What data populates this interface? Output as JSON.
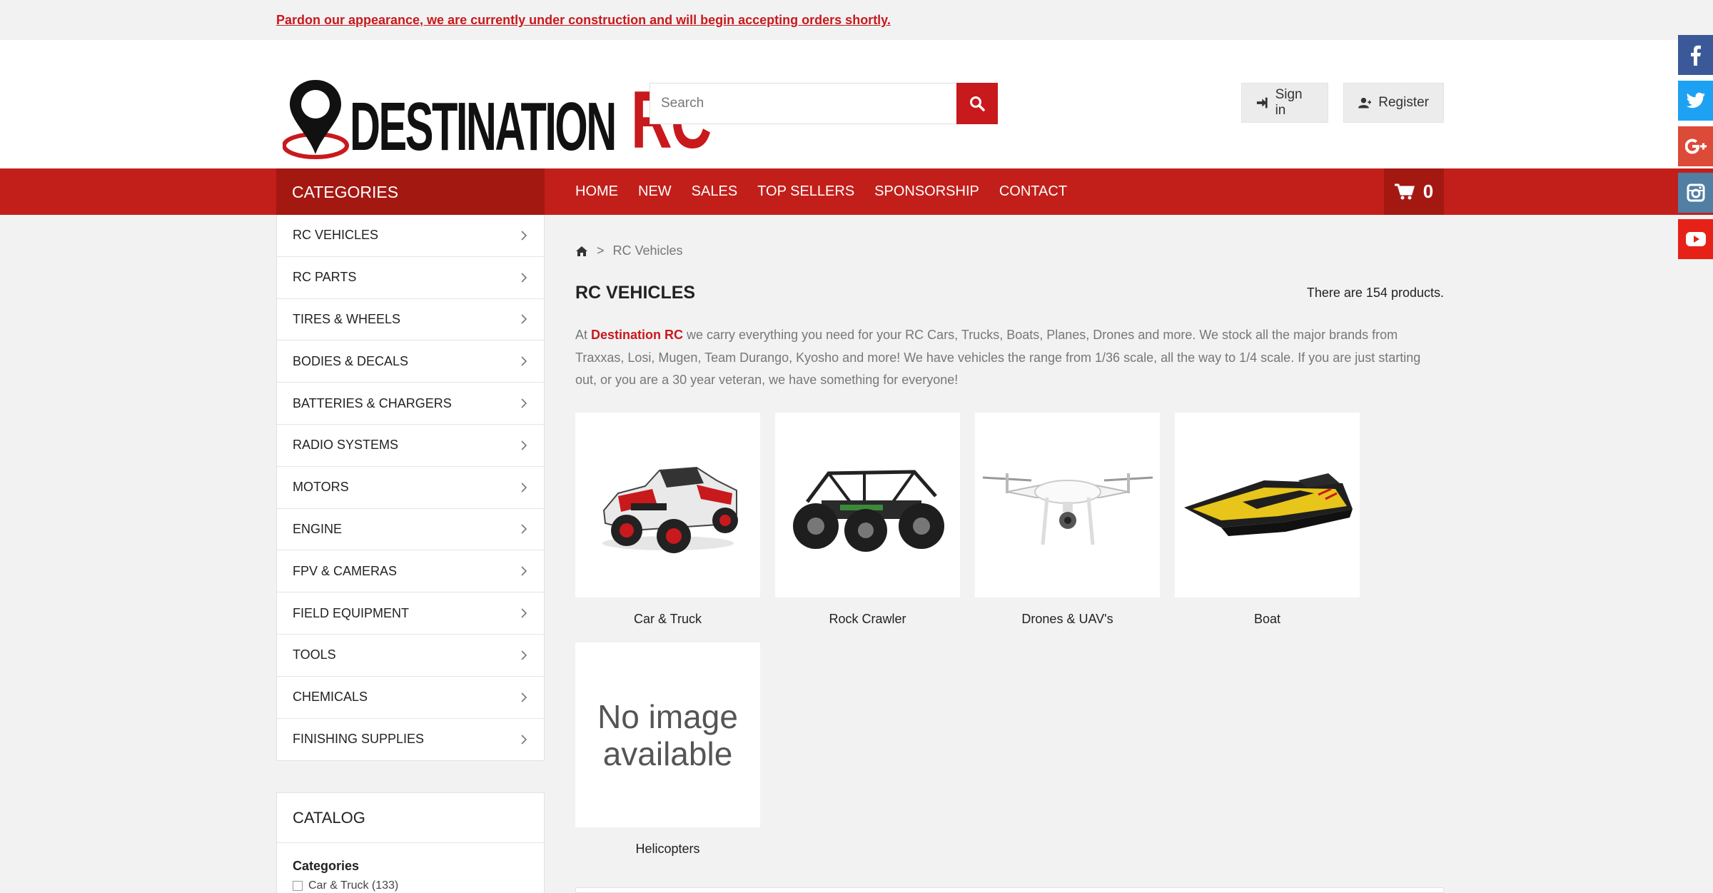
{
  "notice": "Pardon our appearance, we are currently under construction and will begin accepting orders shortly.",
  "brand": {
    "part1": "DESTINATION",
    "part2": "RC",
    "accent_color": "#c8191d"
  },
  "search": {
    "placeholder": "Search"
  },
  "header": {
    "signin_label": "Sign in",
    "register_label": "Register"
  },
  "nav": {
    "categories_title": "CATEGORIES",
    "items": [
      "HOME",
      "NEW",
      "SALES",
      "TOP SELLERS",
      "SPONSORSHIP",
      "CONTACT"
    ],
    "cart_count": "0"
  },
  "sidebar": {
    "categories": [
      "RC VEHICLES",
      "RC PARTS",
      "TIRES & WHEELS",
      "BODIES & DECALS",
      "BATTERIES & CHARGERS",
      "RADIO SYSTEMS",
      "MOTORS",
      "ENGINE",
      "FPV & CAMERAS",
      "FIELD EQUIPMENT",
      "TOOLS",
      "CHEMICALS",
      "FINISHING SUPPLIES"
    ],
    "catalog_title": "CATALOG",
    "catalog_subtitle": "Categories",
    "catalog_first_option": "Car & Truck (133)"
  },
  "main": {
    "breadcrumb_current": "RC Vehicles",
    "breadcrumb_separator": ">",
    "title": "RC VEHICLES",
    "product_count": "There are 154 products.",
    "desc_prefix": "At ",
    "desc_brand": "Destination RC",
    "desc_rest": " we carry everything you need for your RC Cars, Trucks, Boats, Planes, Drones and more. We stock all the major brands from Traxxas, Losi, Mugen, Team Durango, Kyosho and more! We have vehicles the range from 1/36 scale, all the way to 1/4 scale. If you are just starting out, or you are a 30 year veteran, we have something for everyone!",
    "subcategories": [
      {
        "label": "Car & Truck",
        "icon": "rc-truck-image"
      },
      {
        "label": "Rock Crawler",
        "icon": "rock-crawler-image"
      },
      {
        "label": "Drones & UAV's",
        "icon": "drone-image"
      },
      {
        "label": "Boat",
        "icon": "boat-image"
      },
      {
        "label": "Helicopters",
        "icon": "no-image-placeholder"
      }
    ],
    "no_image_text_line1": "No image",
    "no_image_text_line2": "available"
  },
  "social": [
    {
      "name": "facebook",
      "color": "#3b5998"
    },
    {
      "name": "twitter",
      "color": "#1da1f2"
    },
    {
      "name": "google-plus",
      "color": "#dc4a38"
    },
    {
      "name": "instagram",
      "color": "#517fa4"
    },
    {
      "name": "youtube",
      "color": "#e62117"
    }
  ]
}
